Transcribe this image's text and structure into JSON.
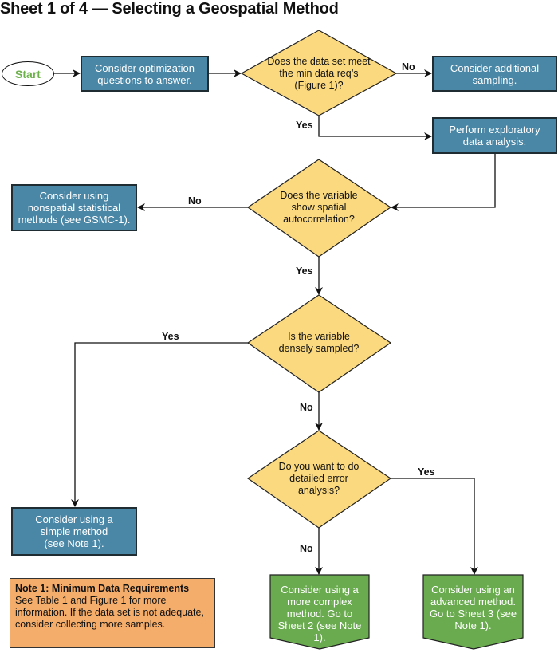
{
  "title": "Sheet 1 of 4 — Selecting a Geospatial Method",
  "colors": {
    "process_box": "#4a87a6",
    "decision": "#fbd97f",
    "terminal_green": "#6aab4f",
    "note": "#f4ad6a",
    "start_text": "#6db14b"
  },
  "nodes": {
    "start": "Start",
    "optimization": "Consider optimization questions to answer.",
    "decision_min_data": "Does the data set meet the min data req’s (Figure 1)?",
    "additional_sampling": "Consider additional sampling.",
    "exploratory": "Perform exploratory data analysis.",
    "decision_autocorrelation": "Does the variable show spatial autocorrelation?",
    "nonspatial": "Consider using nonspatial statistical methods (see GSMC-1).",
    "decision_dense": "Is the variable densely sampled?",
    "simple_method": "Consider using a simple method (see Note 1).",
    "decision_error": "Do you want to do detailed error analysis?",
    "complex_method": "Consider using a more complex method. Go to Sheet 2 (see Note 1).",
    "advanced_method": "Consider using an advanced method. Go to Sheet 3 (see Note 1)."
  },
  "edge_labels": {
    "min_data_no": "No",
    "min_data_yes": "Yes",
    "autocorr_no": "No",
    "autocorr_yes": "Yes",
    "dense_yes": "Yes",
    "dense_no": "No",
    "error_yes": "Yes",
    "error_no": "No"
  },
  "note": {
    "title": "Note 1: Minimum Data Requirements",
    "body": "See Table 1 and Figure 1 for more information. If the data set is not adequate, consider collecting more samples."
  }
}
